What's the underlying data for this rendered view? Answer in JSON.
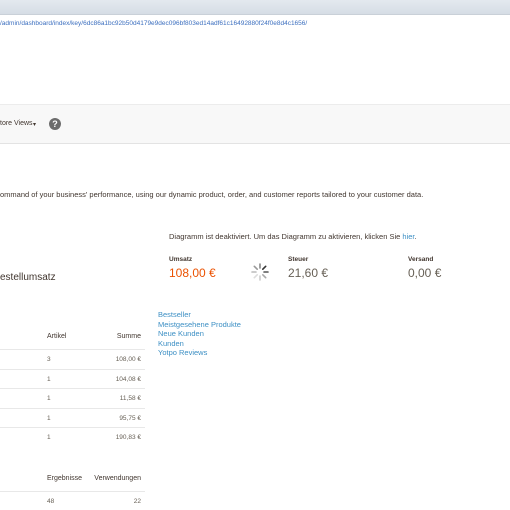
{
  "browser": {
    "url": "/admin/dashboard/index/key/6dc86a1bc92b50d4179e9dec096bf803ed14adf61c16492880f24f0e8d4c1656/"
  },
  "header": {
    "store_views_label": "tore Views",
    "caret": "▾",
    "help_icon": "?"
  },
  "intro_text": "ommand of your business' performance, using our dynamic product, order, and customer reports tailored to your customer data.",
  "sidebar": {
    "section_title": "estellumsatz"
  },
  "chart": {
    "disabled_message": "Diagramm ist deaktiviert. Um das Diagramm zu aktivieren, klicken Sie",
    "enable_link": "hier",
    "period": "."
  },
  "totals": [
    {
      "label": "Umsatz",
      "value": "108,00 €"
    },
    {
      "label": "Steuer",
      "value": "21,60 €"
    },
    {
      "label": "Versand",
      "value": "0,00 €"
    }
  ],
  "tabs": [
    "Bestseller",
    "Meistgesehene Produkte",
    "Neue Kunden",
    "Kunden",
    "Yotpo Reviews"
  ],
  "orders_grid": {
    "columns": [
      "Artikel",
      "Summe"
    ],
    "rows": [
      {
        "items": "3",
        "total": "108,00 €"
      },
      {
        "items": "1",
        "total": "104,08 €"
      },
      {
        "items": "1",
        "total": "11,58 €"
      },
      {
        "items": "1",
        "total": "95,75 €"
      },
      {
        "items": "1",
        "total": "190,83 €"
      }
    ]
  },
  "search_grid": {
    "columns": [
      "Ergebnisse",
      "Verwendungen"
    ],
    "rows": [
      {
        "results": "48",
        "uses": "22"
      }
    ]
  },
  "colors": {
    "accent": "#eb5202",
    "link": "#3c8fc4",
    "text": "#41362f"
  }
}
